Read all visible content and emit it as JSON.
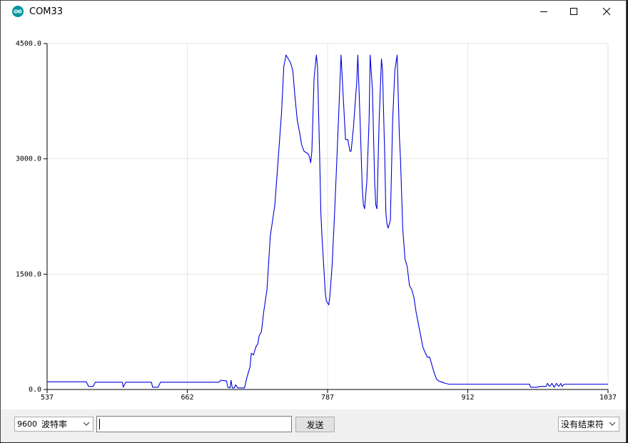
{
  "window": {
    "title": "COM33",
    "controls": {
      "minimize": "minimize-icon",
      "maximize": "maximize-icon",
      "close": "close-icon"
    }
  },
  "toolbar": {
    "baud_rate": {
      "value": "9600",
      "label": "波特率"
    },
    "send_input": {
      "value": "",
      "placeholder": ""
    },
    "send_label": "发送",
    "line_ending": "没有结束符"
  },
  "colors": {
    "series": "#0000dd",
    "accent": "#00979c",
    "grid": "#e6e6e6"
  },
  "chart_data": {
    "type": "line",
    "grid": true,
    "xlim": [
      537,
      1037
    ],
    "ylim": [
      0,
      4500
    ],
    "x_ticks": [
      "537",
      "662",
      "787",
      "912",
      "1037"
    ],
    "y_ticks": [
      "4500.0",
      "3000.0",
      "1500.0",
      "0.0"
    ],
    "series": [
      {
        "points": [
          [
            537,
            100
          ],
          [
            572,
            100
          ],
          [
            574,
            40
          ],
          [
            578,
            40
          ],
          [
            580,
            95
          ],
          [
            604,
            95
          ],
          [
            605,
            30
          ],
          [
            607,
            95
          ],
          [
            630,
            95
          ],
          [
            631,
            30
          ],
          [
            636,
            30
          ],
          [
            638,
            95
          ],
          [
            690,
            95
          ],
          [
            692,
            120
          ],
          [
            697,
            110
          ],
          [
            698,
            30
          ],
          [
            700,
            20
          ],
          [
            701,
            120
          ],
          [
            702,
            20
          ],
          [
            704,
            20
          ],
          [
            705,
            60
          ],
          [
            707,
            20
          ],
          [
            713,
            20
          ],
          [
            715,
            150
          ],
          [
            718,
            300
          ],
          [
            719,
            470
          ],
          [
            721,
            450
          ],
          [
            723,
            550
          ],
          [
            725,
            600
          ],
          [
            726,
            700
          ],
          [
            728,
            750
          ],
          [
            730,
            1000
          ],
          [
            733,
            1300
          ],
          [
            736,
            2000
          ],
          [
            738,
            2200
          ],
          [
            740,
            2400
          ],
          [
            742,
            2800
          ],
          [
            744,
            3200
          ],
          [
            746,
            3600
          ],
          [
            748,
            4200
          ],
          [
            750,
            4350
          ],
          [
            752,
            4300
          ],
          [
            754,
            4250
          ],
          [
            756,
            4150
          ],
          [
            758,
            3800
          ],
          [
            760,
            3500
          ],
          [
            762,
            3350
          ],
          [
            764,
            3180
          ],
          [
            766,
            3100
          ],
          [
            768,
            3080
          ],
          [
            770,
            3060
          ],
          [
            771,
            3020
          ],
          [
            772,
            2950
          ],
          [
            773,
            3100
          ],
          [
            775,
            4050
          ],
          [
            777,
            4350
          ],
          [
            778,
            4200
          ],
          [
            780,
            3000
          ],
          [
            781,
            2300
          ],
          [
            782,
            2000
          ],
          [
            784,
            1500
          ],
          [
            785,
            1250
          ],
          [
            786,
            1150
          ],
          [
            788,
            1100
          ],
          [
            789,
            1200
          ],
          [
            791,
            1600
          ],
          [
            793,
            2200
          ],
          [
            795,
            2900
          ],
          [
            797,
            3600
          ],
          [
            799,
            4350
          ],
          [
            801,
            3800
          ],
          [
            803,
            3250
          ],
          [
            805,
            3250
          ],
          [
            807,
            3100
          ],
          [
            808,
            3100
          ],
          [
            810,
            3400
          ],
          [
            812,
            3800
          ],
          [
            813,
            4000
          ],
          [
            814,
            4350
          ],
          [
            816,
            3500
          ],
          [
            818,
            2600
          ],
          [
            819,
            2400
          ],
          [
            820,
            2350
          ],
          [
            822,
            2700
          ],
          [
            824,
            3500
          ],
          [
            825,
            4350
          ],
          [
            827,
            3900
          ],
          [
            829,
            2700
          ],
          [
            830,
            2400
          ],
          [
            831,
            2350
          ],
          [
            833,
            3500
          ],
          [
            835,
            4300
          ],
          [
            836,
            4150
          ],
          [
            838,
            3000
          ],
          [
            839,
            2300
          ],
          [
            840,
            2150
          ],
          [
            841,
            2100
          ],
          [
            843,
            2200
          ],
          [
            845,
            3500
          ],
          [
            847,
            4150
          ],
          [
            849,
            4350
          ],
          [
            851,
            3300
          ],
          [
            852,
            3000
          ],
          [
            854,
            2100
          ],
          [
            856,
            1700
          ],
          [
            858,
            1600
          ],
          [
            860,
            1350
          ],
          [
            862,
            1300
          ],
          [
            864,
            1200
          ],
          [
            866,
            1000
          ],
          [
            868,
            850
          ],
          [
            870,
            700
          ],
          [
            872,
            550
          ],
          [
            874,
            480
          ],
          [
            876,
            420
          ],
          [
            878,
            420
          ],
          [
            880,
            320
          ],
          [
            882,
            220
          ],
          [
            884,
            140
          ],
          [
            886,
            110
          ],
          [
            888,
            100
          ],
          [
            890,
            90
          ],
          [
            892,
            80
          ],
          [
            895,
            70
          ],
          [
            930,
            70
          ],
          [
            967,
            70
          ],
          [
            968,
            30
          ],
          [
            974,
            30
          ],
          [
            976,
            40
          ],
          [
            982,
            40
          ],
          [
            983,
            80
          ],
          [
            985,
            40
          ],
          [
            987,
            80
          ],
          [
            989,
            30
          ],
          [
            991,
            80
          ],
          [
            993,
            40
          ],
          [
            995,
            80
          ],
          [
            996,
            40
          ],
          [
            998,
            70
          ],
          [
            1037,
            70
          ]
        ]
      }
    ]
  }
}
